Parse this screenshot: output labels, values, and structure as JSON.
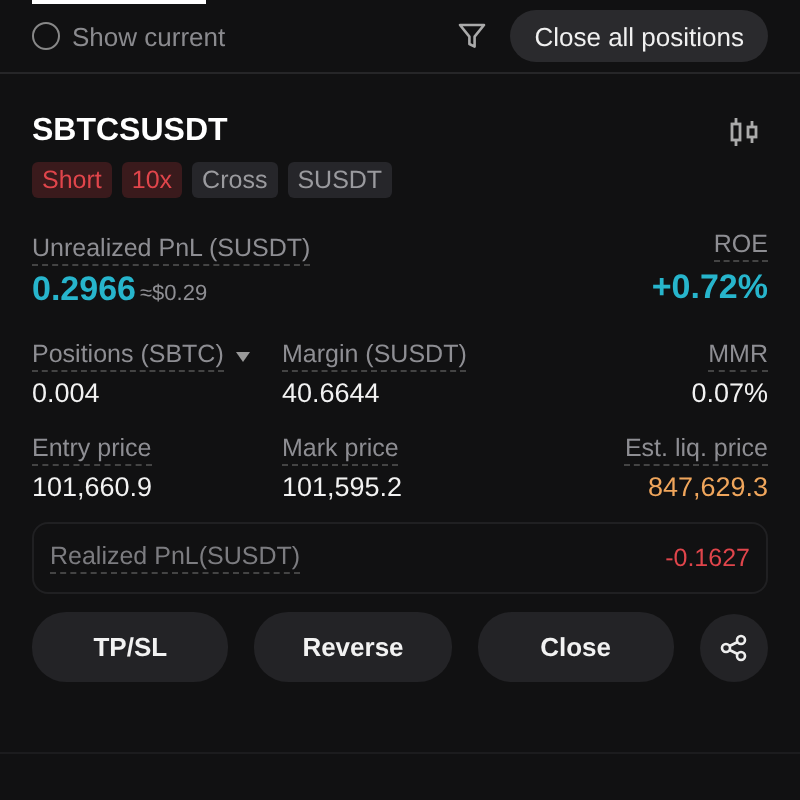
{
  "toolbar": {
    "show_current": {
      "label": "Show current",
      "checked": false
    },
    "close_all_button": "Close all positions"
  },
  "position": {
    "symbol": "SBTCSUSDT",
    "tags": [
      {
        "label": "Short",
        "kind": "side"
      },
      {
        "label": "10x",
        "kind": "side"
      },
      {
        "label": "Cross",
        "kind": "neutral"
      },
      {
        "label": "SUSDT",
        "kind": "neutral"
      }
    ],
    "pnl": {
      "label": "Unrealized PnL (SUSDT)",
      "value": "0.2966",
      "approx": "≈$0.29",
      "roe_label": "ROE",
      "roe_value": "+0.72%"
    },
    "stats": [
      {
        "label": "Positions (SBTC)",
        "value": "0.004",
        "kind": "menu"
      },
      {
        "label": "Margin (SUSDT)",
        "value": "40.6644",
        "kind": "plain"
      },
      {
        "label": "MMR",
        "value": "0.07%",
        "kind": "plain"
      },
      {
        "label": "Entry price",
        "value": "101,660.9",
        "kind": "plain"
      },
      {
        "label": "Mark price",
        "value": "101,595.2",
        "kind": "plain"
      },
      {
        "label": "Est. liq. price",
        "value": "847,629.3",
        "kind": "warning"
      }
    ],
    "realized": {
      "label": "Realized PnL(SUSDT)",
      "value": "-0.1627"
    },
    "buttons": [
      "TP/SL",
      "Reverse",
      "Close"
    ]
  }
}
